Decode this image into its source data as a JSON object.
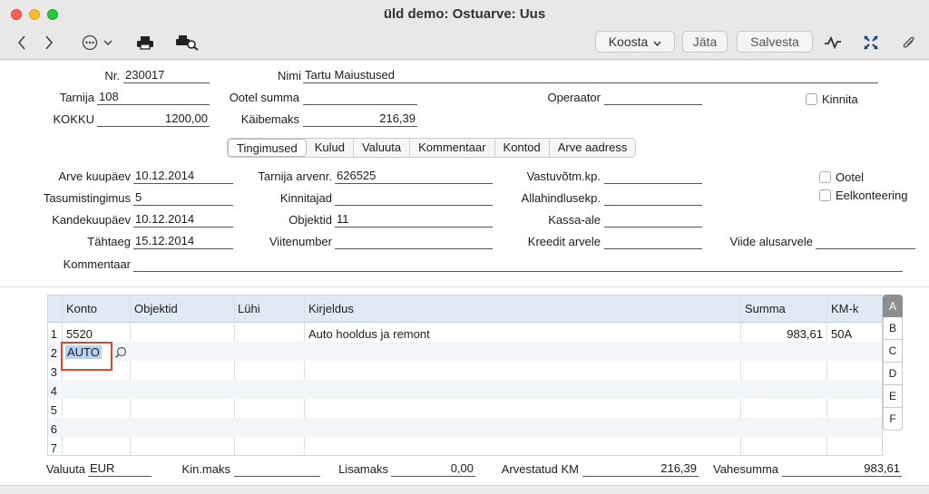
{
  "window": {
    "title": "üld demo: Ostuarve: Uus"
  },
  "toolbar": {
    "back_icon": "chevron-left-icon",
    "forward_icon": "chevron-right-icon",
    "koosta": "Koosta",
    "jata": "Jäta",
    "salvesta": "Salvesta"
  },
  "header": {
    "nr_label": "Nr.",
    "nr_value": "230017",
    "nimi_label": "Nimi",
    "nimi_value": "Tartu Maiustused",
    "tarnija_label": "Tarnija",
    "tarnija_value": "108",
    "ootel_summa_label": "Ootel summa",
    "ootel_summa_value": "",
    "operaator_label": "Operaator",
    "operaator_value": "",
    "kinnita_label": "Kinnita",
    "kokku_label": "KOKKU",
    "kokku_value": "1200,00",
    "kaibemaks_label": "Käibemaks",
    "kaibemaks_value": "216,39"
  },
  "tabs": [
    "Tingimused",
    "Kulud",
    "Valuuta",
    "Kommentaar",
    "Kontod",
    "Arve aadress"
  ],
  "terms": {
    "arve_kuupaev_label": "Arve kuupäev",
    "arve_kuupaev_value": "10.12.2014",
    "tarnija_arvenr_label": "Tarnija arvenr.",
    "tarnija_arvenr_value": "626525",
    "vastuvotm_label": "Vastuvõtm.kp.",
    "vastuvotm_value": "",
    "ootel_label": "Ootel",
    "tasumistingimus_label": "Tasumistingimus",
    "tasumistingimus_value": "5",
    "kinnitajad_label": "Kinnitajad",
    "kinnitajad_value": "",
    "allahindlusekp_label": "Allahindlusekp.",
    "allahindlusekp_value": "",
    "eelkonteering_label": "Eelkonteering",
    "kandekuupaev_label": "Kandekuupäev",
    "kandekuupaev_value": "10.12.2014",
    "objektid_label": "Objektid",
    "objektid_value": "11",
    "kassa_ale_label": "Kassa-ale",
    "kassa_ale_value": "",
    "tahtaeg_label": "Tähtaeg",
    "tahtaeg_value": "15.12.2014",
    "viitenumber_label": "Viitenumber",
    "viitenumber_value": "",
    "kreedit_label": "Kreedit arvele",
    "kreedit_value": "",
    "viide_label": "Viide alusarvele",
    "viide_value": "",
    "kommentaar_label": "Kommentaar",
    "kommentaar_value": ""
  },
  "grid": {
    "columns": [
      "Konto",
      "Objektid",
      "Lühi",
      "Kirjeldus",
      "Summa",
      "KM-k"
    ],
    "rows": [
      {
        "n": "1",
        "konto": "5520",
        "objektid": "",
        "luhi": "",
        "kirjeldus": "Auto hooldus ja remont",
        "summa": "983,61",
        "kmk": "50A"
      },
      {
        "n": "2",
        "konto": "AUTO",
        "objektid": "",
        "luhi": "",
        "kirjeldus": "",
        "summa": "",
        "kmk": ""
      },
      {
        "n": "3",
        "konto": "",
        "objektid": "",
        "luhi": "",
        "kirjeldus": "",
        "summa": "",
        "kmk": ""
      },
      {
        "n": "4",
        "konto": "",
        "objektid": "",
        "luhi": "",
        "kirjeldus": "",
        "summa": "",
        "kmk": ""
      },
      {
        "n": "5",
        "konto": "",
        "objektid": "",
        "luhi": "",
        "kirjeldus": "",
        "summa": "",
        "kmk": ""
      },
      {
        "n": "6",
        "konto": "",
        "objektid": "",
        "luhi": "",
        "kirjeldus": "",
        "summa": "",
        "kmk": ""
      },
      {
        "n": "7",
        "konto": "",
        "objektid": "",
        "luhi": "",
        "kirjeldus": "",
        "summa": "",
        "kmk": ""
      }
    ],
    "letters": [
      "A",
      "B",
      "C",
      "D",
      "E",
      "F"
    ]
  },
  "footer": {
    "valuuta_label": "Valuuta",
    "valuuta_value": "EUR",
    "kinmaks_label": "Kin.maks",
    "kinmaks_value": "",
    "lisamaks_label": "Lisamaks",
    "lisamaks_value": "0,00",
    "arvestatud_label": "Arvestatud KM",
    "arvestatud_value": "216,39",
    "vahesumma_label": "Vahesumma",
    "vahesumma_value": "983,61"
  }
}
